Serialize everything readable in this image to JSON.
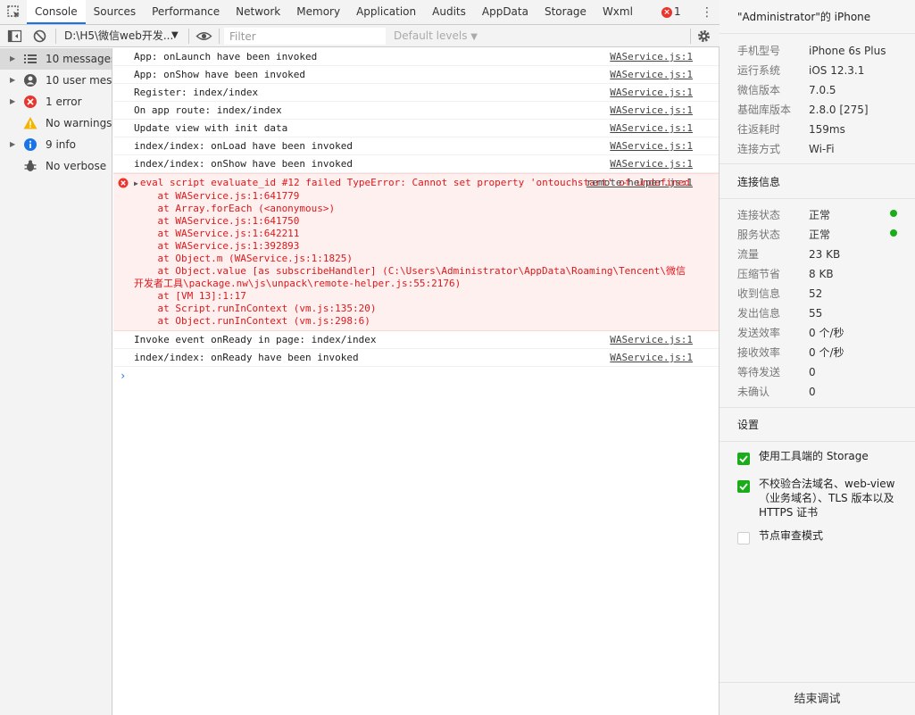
{
  "tabs": [
    "Console",
    "Sources",
    "Performance",
    "Network",
    "Memory",
    "Application",
    "Audits",
    "AppData",
    "Storage",
    "Wxml"
  ],
  "active_tab": "Console",
  "error_count": "1",
  "toolbar": {
    "context": "D:\\H5\\微信web开发...",
    "filter_placeholder": "Filter",
    "levels": "Default levels"
  },
  "sidebar": {
    "items": [
      {
        "label": "10 messages",
        "icon": "list-icon"
      },
      {
        "label": "10 user mes...",
        "icon": "user-icon"
      },
      {
        "label": "1 error",
        "icon": "error-icon"
      },
      {
        "label": "No warnings",
        "icon": "warning-icon"
      },
      {
        "label": "9 info",
        "icon": "info-icon"
      },
      {
        "label": "No verbose",
        "icon": "bug-icon"
      }
    ]
  },
  "console": {
    "messages": [
      {
        "text": "App: onLaunch have been invoked",
        "source": "WAService.js:1"
      },
      {
        "text": "App: onShow have been invoked",
        "source": "WAService.js:1"
      },
      {
        "text": "Register: index/index",
        "source": "WAService.js:1"
      },
      {
        "text": "On app route: index/index",
        "source": "WAService.js:1"
      },
      {
        "text": "Update view with init data",
        "source": "WAService.js:1"
      },
      {
        "text": "index/index: onLoad have been invoked",
        "source": "WAService.js:1"
      },
      {
        "text": "index/index: onShow have been invoked",
        "source": "WAService.js:1"
      }
    ],
    "error": {
      "text": "eval script evaluate_id #12 failed TypeError: Cannot set property 'ontouchstart' of undefined",
      "source": "remote-helper.js:1",
      "stack": [
        "    at WAService.js:1:641779",
        "    at Array.forEach (<anonymous>)",
        "    at WAService.js:1:641750",
        "    at WAService.js:1:642211",
        "    at WAService.js:1:392893",
        "    at Object.m (WAService.js:1:1825)",
        "    at Object.value [as subscribeHandler] (C:\\Users\\Administrator\\AppData\\Roaming\\Tencent\\微信开发者工具\\package.nw\\js\\unpack\\remote-helper.js:55:2176)",
        "    at [VM 13]:1:17",
        "    at Script.runInContext (vm.js:135:20)",
        "    at Object.runInContext (vm.js:298:6)"
      ]
    },
    "after": [
      {
        "text": "Invoke event onReady in page: index/index",
        "source": "WAService.js:1"
      },
      {
        "text": "index/index: onReady have been invoked",
        "source": "WAService.js:1"
      }
    ],
    "prompt": "›"
  },
  "panel": {
    "title": "\"Administrator\"的 iPhone",
    "device": [
      {
        "k": "手机型号",
        "v": "iPhone 6s Plus"
      },
      {
        "k": "运行系统",
        "v": "iOS 12.3.1"
      },
      {
        "k": "微信版本",
        "v": "7.0.5"
      },
      {
        "k": "基础库版本",
        "v": "2.8.0 [275]"
      },
      {
        "k": "往返耗时",
        "v": "159ms"
      },
      {
        "k": "连接方式",
        "v": "Wi-Fi"
      }
    ],
    "conn_title": "连接信息",
    "conn": [
      {
        "k": "连接状态",
        "v": "正常",
        "dot": true
      },
      {
        "k": "服务状态",
        "v": "正常",
        "dot": true
      },
      {
        "k": "流量",
        "v": "23 KB"
      },
      {
        "k": "压缩节省",
        "v": "8 KB"
      },
      {
        "k": "收到信息",
        "v": "52"
      },
      {
        "k": "发出信息",
        "v": "55"
      },
      {
        "k": "发送效率",
        "v": "0 个/秒"
      },
      {
        "k": "接收效率",
        "v": "0 个/秒"
      },
      {
        "k": "等待发送",
        "v": "0"
      },
      {
        "k": "未确认",
        "v": "0"
      }
    ],
    "settings_title": "设置",
    "settings": [
      {
        "label": "使用工具端的 Storage",
        "checked": true
      },
      {
        "label": "不校验合法域名、web-view（业务域名）、TLS 版本以及 HTTPS 证书",
        "checked": true
      },
      {
        "label": "节点审查模式",
        "checked": false
      }
    ],
    "end_button": "结束调试"
  },
  "colors": {
    "accent": "#1a73e8",
    "error": "#e0171a",
    "ok": "#1aad19"
  }
}
